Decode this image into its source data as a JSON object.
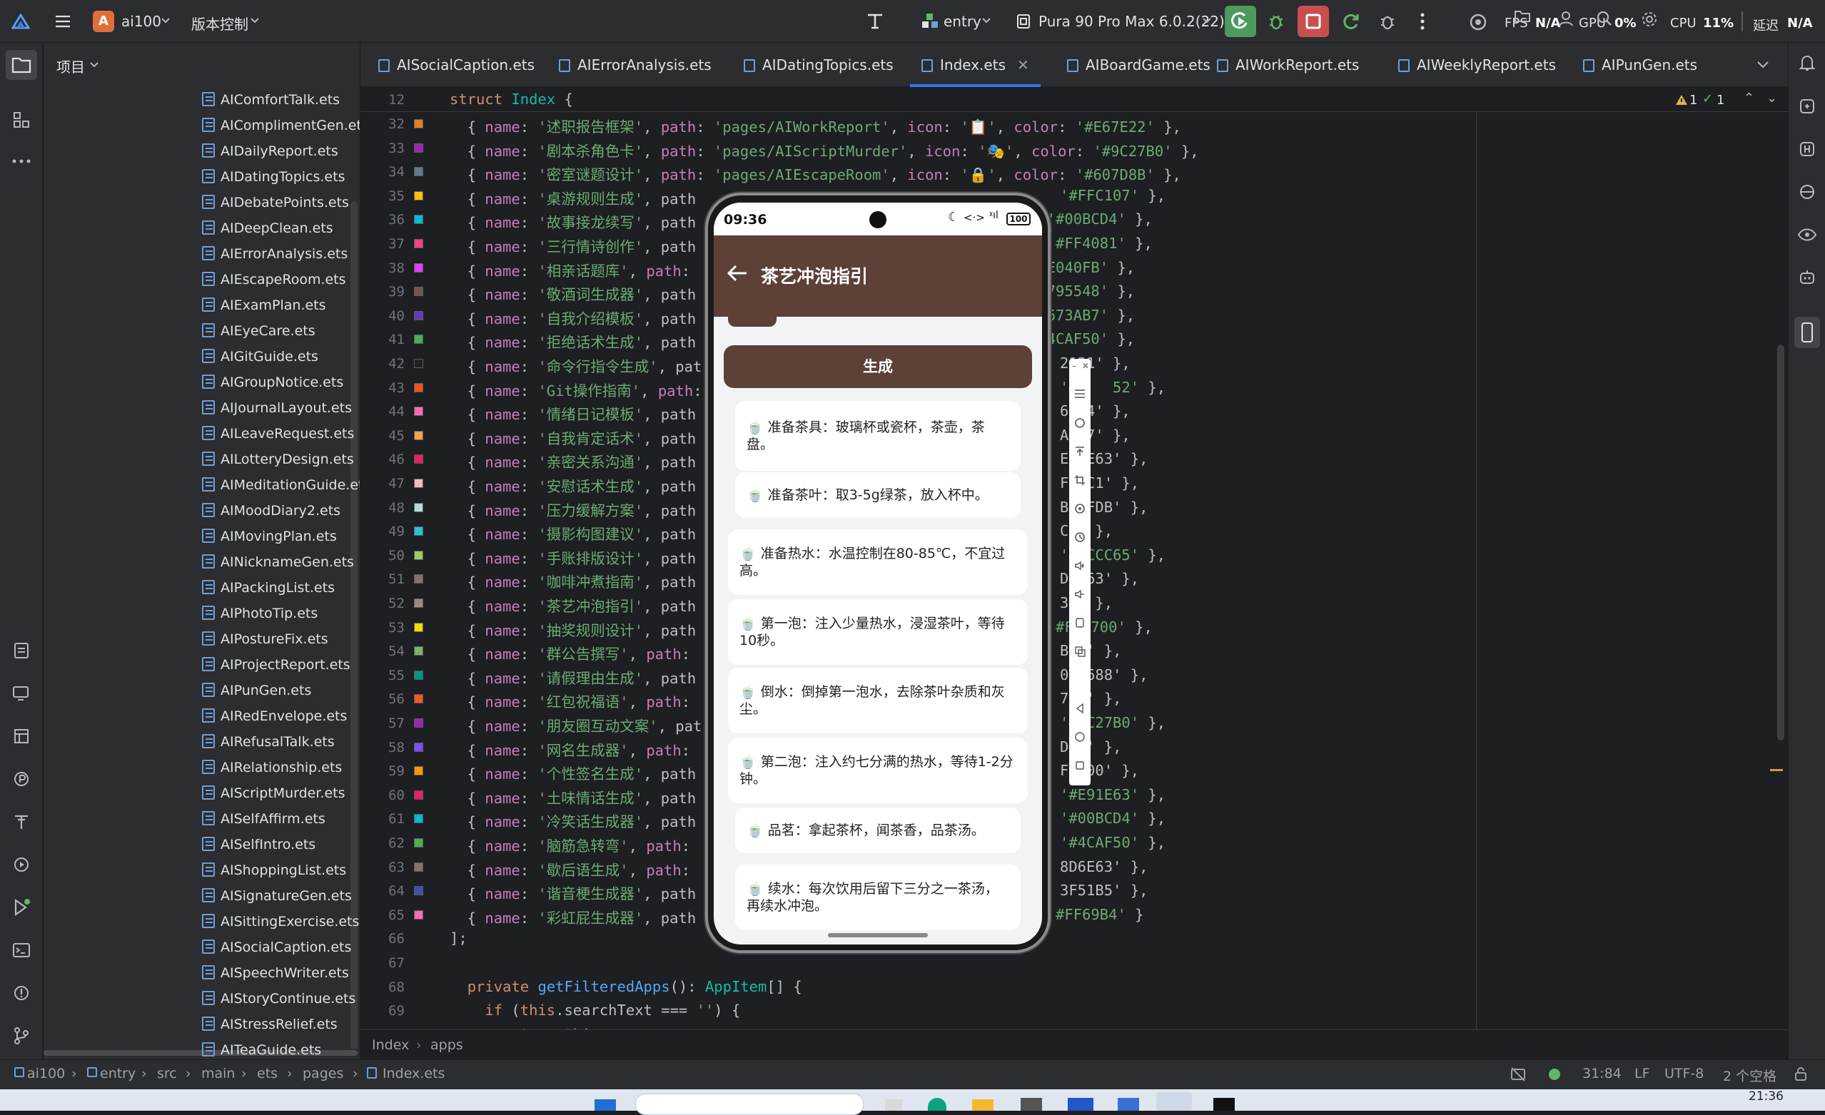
{
  "topbar": {
    "project_badge": "A",
    "project_name": "ai100",
    "vcs_label": "版本控制",
    "run_config": "entry",
    "device": "Pura 90 Pro Max 6.0.2(22)",
    "fps_label": "FPS",
    "fps_value": "N/A",
    "gpu_label": "GPU",
    "gpu_value": "0%",
    "cpu_label": "CPU",
    "cpu_value": "11%",
    "latency_label": "延迟",
    "latency_value": "N/A"
  },
  "project_panel": {
    "title": "项目",
    "files": [
      "AIComfortTalk.ets",
      "AIComplimentGen.ets",
      "AIDailyReport.ets",
      "AIDatingTopics.ets",
      "AIDebatePoints.ets",
      "AIDeepClean.ets",
      "AIErrorAnalysis.ets",
      "AIEscapeRoom.ets",
      "AIExamPlan.ets",
      "AIEyeCare.ets",
      "AIGitGuide.ets",
      "AIGroupNotice.ets",
      "AIJournalLayout.ets",
      "AILeaveRequest.ets",
      "AILotteryDesign.ets",
      "AIMeditationGuide.ets",
      "AIMoodDiary2.ets",
      "AIMovingPlan.ets",
      "AINicknameGen.ets",
      "AIPackingList.ets",
      "AIPhotoTip.ets",
      "AIPostureFix.ets",
      "AIProjectReport.ets",
      "AIPunGen.ets",
      "AIRedEnvelope.ets",
      "AIRefusalTalk.ets",
      "AIRelationship.ets",
      "AIScriptMurder.ets",
      "AISelfAffirm.ets",
      "AISelfIntro.ets",
      "AIShoppingList.ets",
      "AISignatureGen.ets",
      "AISittingExercise.ets",
      "AISocialCaption.ets",
      "AISpeechWriter.ets",
      "AIStoryContinue.ets",
      "AIStressRelief.ets",
      "AITeaGuide.ets"
    ]
  },
  "tabs": [
    "AISocialCaption.ets",
    "AIErrorAnalysis.ets",
    "AIDatingTopics.ets",
    "Index.ets",
    "AIBoardGame.ets",
    "AIWorkReport.ets",
    "AIWeeklyReport.ets",
    "AIPunGen.ets"
  ],
  "editor": {
    "warnings": "1",
    "checks": "1",
    "sticky_line_no": "12",
    "sticky_line": "struct Index {",
    "lines": [
      {
        "no": "32",
        "code": "  { name: '述职报告框架', path: 'pages/AIWorkReport', icon: '📋', color: '#E67E22' },",
        "sw": "#e67e22"
      },
      {
        "no": "33",
        "code": "  { name: '剧本杀角色卡', path: 'pages/AIScriptMurder', icon: '🎭', color: '#9C27B0' },",
        "sw": "#9c27b0"
      },
      {
        "no": "34",
        "code": "  { name: '密室谜题设计', path: 'pages/AIEscapeRoom', icon: '🔒', color: '#607D8B' },",
        "sw": "#607d8b"
      },
      {
        "no": "35",
        "code": "  { name: '桌游规则生成', path",
        "tail": "'#FFC107' },",
        "sw": "#ffc107"
      },
      {
        "no": "36",
        "code": "  { name: '故事接龙续写', path",
        "tail": "lor: '#00BCD4' },",
        "sw": "#00bcd4"
      },
      {
        "no": "37",
        "code": "  { name: '三行情诗创作', path",
        "tail": "lor: '#FF4081' },",
        "sw": "#ff4081"
      },
      {
        "no": "38",
        "code": "  { name: '相亲话题库', path:",
        "tail": "r: '#E040FB' },",
        "sw": "#e040fb"
      },
      {
        "no": "39",
        "code": "  { name: '敬酒词生成器', path",
        "tail": "r: '#795548' },",
        "sw": "#795548"
      },
      {
        "no": "40",
        "code": "  { name: '自我介绍模板', path",
        "tail": "r: '#673AB7' },",
        "sw": "#673ab7"
      },
      {
        "no": "41",
        "code": "  { name: '拒绝话术生成', path",
        "tail": "r: '#4CAF50' },",
        "sw": "#4caf50"
      },
      {
        "no": "42",
        "code": "  { name: '命令行指令生成', pat",
        "tail": "2121' },",
        "sw": "#212121"
      },
      {
        "no": "43",
        "code": "  { name: 'Git操作指南', path:",
        "tail": "'#    52' },",
        "sw": "#f4511e"
      },
      {
        "no": "44",
        "code": "  { name: '情绪日记模板', path",
        "tail": "69B4' },",
        "sw": "#ff69b4"
      },
      {
        "no": "45",
        "code": "  { name: '自我肯定话术', path",
        "tail": "A047' },",
        "sw": "#ffa047"
      },
      {
        "no": "46",
        "code": "  { name: '亲密关系沟通', path",
        "tail": "E91E63' },",
        "sw": "#e91e63"
      },
      {
        "no": "47",
        "code": "  { name: '安慰话术生成', path",
        "tail": "FB6C1' },",
        "sw": "#ffb6c1"
      },
      {
        "no": "48",
        "code": "  { name: '压力缓解方案', path",
        "tail": "B2DFDB' },",
        "sw": "#b2dfdb"
      },
      {
        "no": "49",
        "code": "  { name: '摄影构图建议', path",
        "tail": "C1' },",
        "sw": "#26c6da"
      },
      {
        "no": "50",
        "code": "  { name: '手账排版设计', path",
        "tail": "'#9CCC65' },",
        "sw": "#9ccc65"
      },
      {
        "no": "51",
        "code": "  { name: '咖啡冲煮指南', path",
        "tail": "D6E63' },",
        "sw": "#8d6e63"
      },
      {
        "no": "52",
        "code": "  { name: '茶艺冲泡指引', path",
        "tail": "37' },",
        "sw": "#a1887f"
      },
      {
        "no": "53",
        "code": "  { name: '抽奖规则设计', path",
        "tail": "lor: '#FFD700' },",
        "sw": "#ffd700"
      },
      {
        "no": "54",
        "code": "  { name: '群公告撰写', path:",
        "tail": "B6A' },",
        "sw": "#78b66a"
      },
      {
        "no": "55",
        "code": "  { name: '请假理由生成', path",
        "tail": "009688' },",
        "sw": "#009688"
      },
      {
        "no": "56",
        "code": "  { name: '红包祝福语', path:",
        "tail": "722' },",
        "sw": "#ff5722"
      },
      {
        "no": "57",
        "code": "  { name: '朋友圈互动文案', pat",
        "tail": "'#9C27B0' },",
        "sw": "#9c27b0"
      },
      {
        "no": "58",
        "code": "  { name: '网名生成器', path:",
        "tail": "DFF' },",
        "sw": "#7c4dff"
      },
      {
        "no": "59",
        "code": "  { name: '个性签名生成', path",
        "tail": "F9800' },",
        "sw": "#ff9800"
      },
      {
        "no": "60",
        "code": "  { name: '土味情话生成', path",
        "tail": "'#E91E63' },",
        "sw": "#e91e63"
      },
      {
        "no": "61",
        "code": "  { name: '冷笑话生成器', path",
        "tail": "'#00BCD4' },",
        "sw": "#00bcd4"
      },
      {
        "no": "62",
        "code": "  { name: '脑筋急转弯', path:",
        "tail": "'#4CAF50' },",
        "sw": "#4caf50"
      },
      {
        "no": "63",
        "code": "  { name: '歇后语生成', path:",
        "tail": "8D6E63' },",
        "sw": "#8d6e63"
      },
      {
        "no": "64",
        "code": "  { name: '谐音梗生成器', path",
        "tail": "3F51B5' },",
        "sw": "#3f51b5"
      },
      {
        "no": "65",
        "code": "  { name: '彩虹屁生成器', path",
        "tail": "lor: '#FF69B4' }",
        "sw": "#ff69b4"
      },
      {
        "no": "66",
        "code": "];"
      },
      {
        "no": "67",
        "code": ""
      },
      {
        "no": "68",
        "code": "  private getFilteredApps(): AppItem[] {"
      },
      {
        "no": "69",
        "code": "    if (this.searchText === '') {"
      },
      {
        "no": "70",
        "code": "      return this.apps;"
      }
    ]
  },
  "phone": {
    "time": "09:36",
    "battery": "100",
    "title": "茶艺冲泡指引",
    "generate_button": "生成",
    "steps": [
      "🍵 准备茶具：玻璃杯或瓷杯，茶壶，茶盘。",
      "🍵 准备茶叶：取3-5g绿茶，放入杯中。",
      "🍵 准备热水：水温控制在80-85℃，不宜过高。",
      "🍵 第一泡：注入少量热水，浸湿茶叶，等待10秒。",
      "🍵 倒水：倒掉第一泡水，去除茶叶杂质和灰尘。",
      "🍵 第二泡：注入约七分满的热水，等待1-2分钟。",
      "🍵 品茗：拿起茶杯，闻茶香，品茶汤。",
      "🍵 续水：每次饮用后留下三分之一茶汤，再续水冲泡。"
    ],
    "header_color": "#5d4037"
  },
  "breadcrumb": [
    "Index",
    "apps"
  ],
  "statusbar": {
    "path": [
      "ai100",
      "entry",
      "src",
      "main",
      "ets",
      "pages",
      "Index.ets"
    ],
    "position": "31:84",
    "line_ending": "LF",
    "encoding": "UTF-8",
    "indent": "2 个空格"
  },
  "taskbar": {
    "clock": "21:36"
  }
}
